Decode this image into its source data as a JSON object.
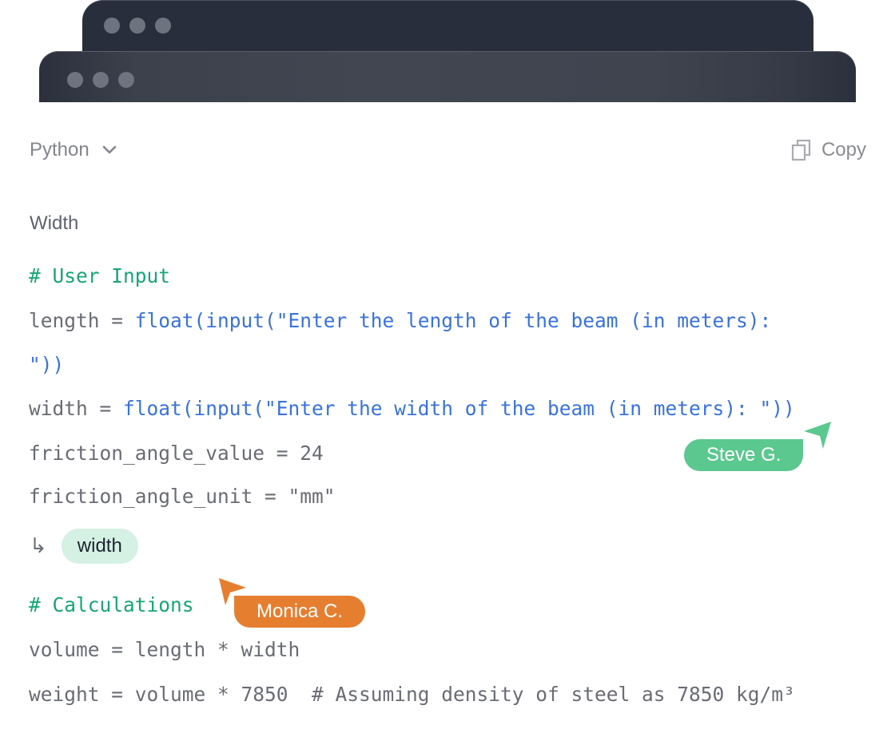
{
  "windows": {
    "back_dots": [
      "dot",
      "dot",
      "dot"
    ],
    "front_dots": [
      "dot",
      "dot",
      "dot"
    ]
  },
  "toolbar": {
    "language": "Python",
    "language_icon": "chevron-down-icon",
    "copy_label": "Copy",
    "copy_icon": "copy-icon"
  },
  "section_title": "Width",
  "code": {
    "line1": "# User Input",
    "line2_var": "length = ",
    "line2_call": "float(input(\"Enter the length of the beam (in meters):",
    "line3": "\"))",
    "line4_var": "width = ",
    "line4_call": "float(input(\"Enter the width of the beam (in meters): \"))",
    "line5": "friction_angle_value = 24",
    "line6": "friction_angle_unit = \"mm\"",
    "line7": "# Calculations",
    "line8": "volume = length * width",
    "line9": "weight = volume * 7850  # Assuming density of steel as 7850 kg/m³"
  },
  "reference": {
    "arrow": "↳",
    "chip_label": "width"
  },
  "cursors": [
    {
      "name": "Steve G.",
      "color": "#5bc88f"
    },
    {
      "name": "Monica C.",
      "color": "#e67e30"
    }
  ],
  "colors": {
    "comment": "#17a673",
    "function": "#3a72dd",
    "text": "#6a6c74",
    "chip_bg": "#d4f1e3"
  }
}
